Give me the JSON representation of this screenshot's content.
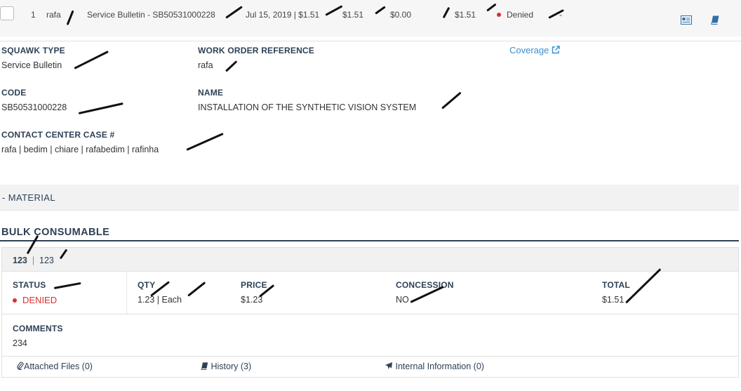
{
  "row": {
    "index": "1",
    "squawk": "rafa",
    "title": "Service Bulletin - SB50531000228",
    "date_price": "Jul 15, 2019 | $1.51",
    "price": "$1.51",
    "zero": "$0.00",
    "total": "$1.51",
    "status": "Denied",
    "dash": "-"
  },
  "details": {
    "squawk_type_label": "SQUAWK TYPE",
    "squawk_type_value": "Service Bulletin",
    "wo_label": "WORK ORDER REFERENCE",
    "wo_value": "rafa",
    "coverage_link": "Coverage",
    "code_label": "CODE",
    "code_value": "SB50531000228",
    "name_label": "NAME",
    "name_value": "INSTALLATION OF THE SYNTHETIC VISION SYSTEM",
    "case_label": "CONTACT CENTER CASE #",
    "case_value": "rafa | bedim | chiare | rafabedim | rafinha"
  },
  "material": {
    "header": "- MATERIAL"
  },
  "bulk": {
    "title": "BULK CONSUMABLE",
    "head_bold": "123",
    "head_sep": "|",
    "head_rest": "123",
    "status_label": "STATUS",
    "status_value": "DENIED",
    "qty_label": "QTY",
    "qty_value": "1.23 | Each",
    "price_label": "PRICE",
    "price_value": "$1.23",
    "concession_label": "CONCESSION",
    "concession_value": "NO",
    "total_label": "TOTAL",
    "total_value": "$1.51",
    "comments_label": "COMMENTS",
    "comments_value": "234"
  },
  "footer": {
    "attached": "Attached Files (0)",
    "history": "History (3)",
    "internal": "Internal Information (0)"
  },
  "colors": {
    "accent": "#3a8fd0",
    "denied": "#d93030",
    "heading": "#2e4155"
  }
}
